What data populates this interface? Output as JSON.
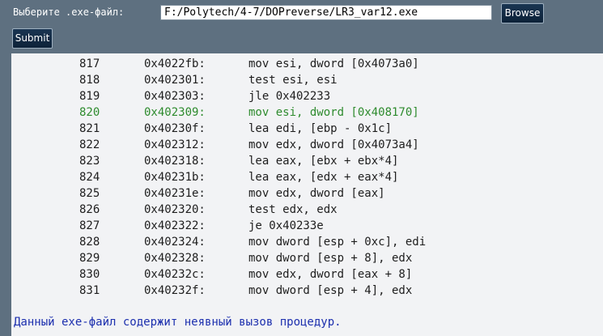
{
  "form": {
    "label": "Выберите .exe-файл:",
    "file_value": "F:/Polytech/4-7/DOPreverse/LR3_var12.exe",
    "browse_label": "Browse",
    "submit_label": "Submit"
  },
  "listing": {
    "rows": [
      {
        "num": "817",
        "addr": "0x4022fb:",
        "instr": "mov esi, dword [0x4073a0]",
        "highlighted": false
      },
      {
        "num": "818",
        "addr": "0x402301:",
        "instr": "test esi, esi",
        "highlighted": false
      },
      {
        "num": "819",
        "addr": "0x402303:",
        "instr": "jle 0x402233",
        "highlighted": false
      },
      {
        "num": "820",
        "addr": "0x402309:",
        "instr": "mov esi, dword [0x408170]",
        "highlighted": true
      },
      {
        "num": "821",
        "addr": "0x40230f:",
        "instr": "lea edi, [ebp - 0x1c]",
        "highlighted": false
      },
      {
        "num": "822",
        "addr": "0x402312:",
        "instr": "mov edx, dword [0x4073a4]",
        "highlighted": false
      },
      {
        "num": "823",
        "addr": "0x402318:",
        "instr": "lea eax, [ebx + ebx*4]",
        "highlighted": false
      },
      {
        "num": "824",
        "addr": "0x40231b:",
        "instr": "lea eax, [edx + eax*4]",
        "highlighted": false
      },
      {
        "num": "825",
        "addr": "0x40231e:",
        "instr": "mov edx, dword [eax]",
        "highlighted": false
      },
      {
        "num": "826",
        "addr": "0x402320:",
        "instr": "test edx, edx",
        "highlighted": false
      },
      {
        "num": "827",
        "addr": "0x402322:",
        "instr": "je 0x40233e",
        "highlighted": false
      },
      {
        "num": "828",
        "addr": "0x402324:",
        "instr": "mov dword [esp + 0xc], edi",
        "highlighted": false
      },
      {
        "num": "829",
        "addr": "0x402328:",
        "instr": "mov dword [esp + 8], edx",
        "highlighted": false
      },
      {
        "num": "830",
        "addr": "0x40232c:",
        "instr": "mov edx, dword [eax + 8]",
        "highlighted": false
      },
      {
        "num": "831",
        "addr": "0x40232f:",
        "instr": "mov dword [esp + 4], edx",
        "highlighted": false
      }
    ]
  },
  "result_message": "Данный exe-файл содержит неявный вызов процедур.",
  "colors": {
    "background": "#5e7080",
    "panel": "#f2f3f5",
    "highlight_text": "#2e8b2e",
    "message_text": "#1c2fae",
    "button_bg": "#132b45"
  }
}
